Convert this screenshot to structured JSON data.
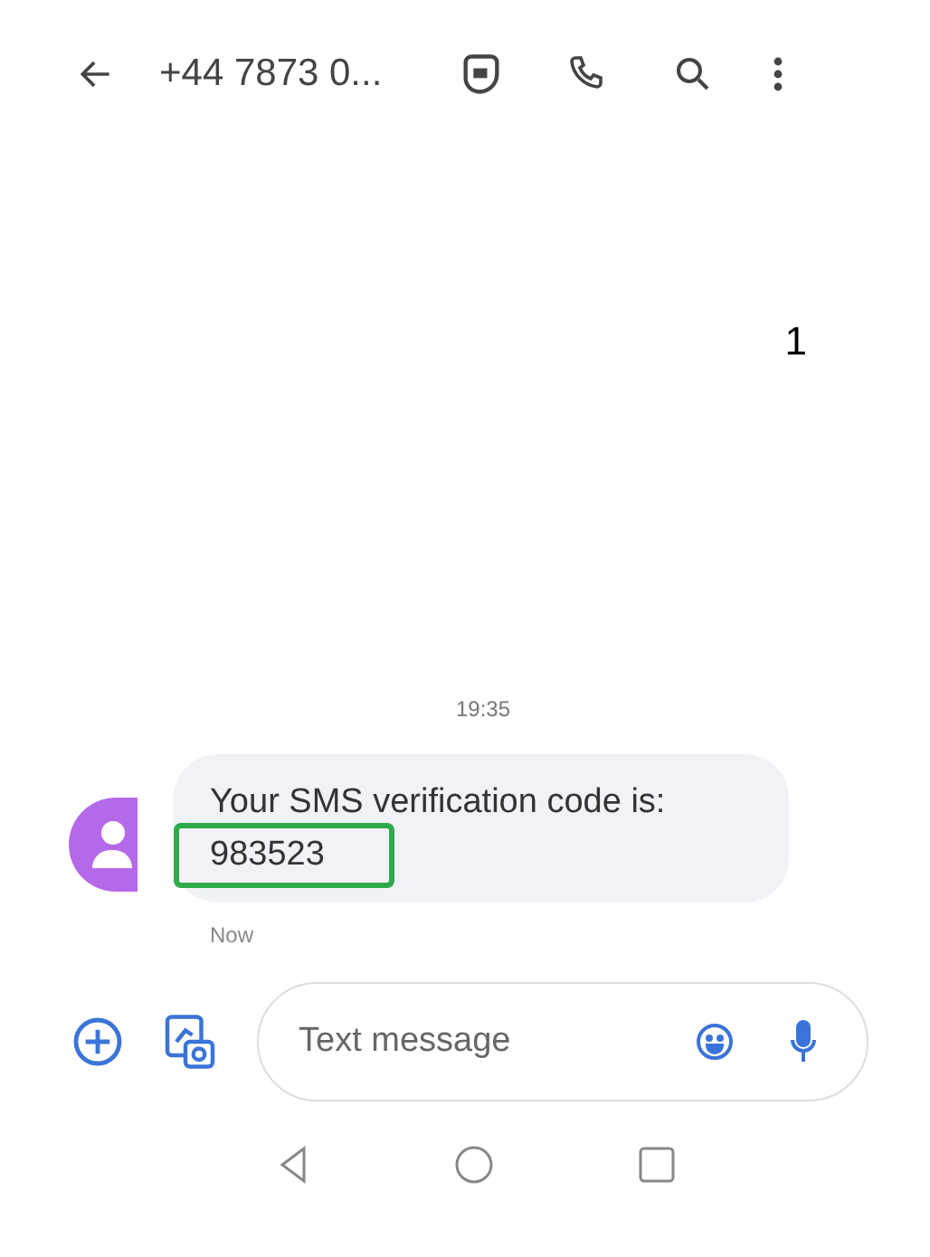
{
  "header": {
    "title": "+44 7873 0..."
  },
  "annotation": "1",
  "timestamp": "19:35",
  "message": {
    "text": "Your SMS verification code is:",
    "code": "983523",
    "code_highlighted": true,
    "time": "Now"
  },
  "composer": {
    "placeholder": "Text message"
  }
}
